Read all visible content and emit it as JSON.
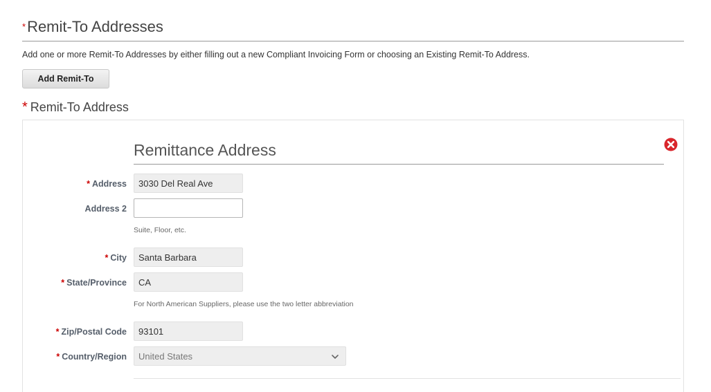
{
  "section": {
    "required_marker": "*",
    "title": "Remit-To Addresses",
    "description": "Add one or more Remit-To Addresses by either filling out a new Compliant Invoicing Form or choosing an Existing Remit-To Address.",
    "add_button_label": "Add Remit-To"
  },
  "subsection": {
    "required_marker": "*",
    "title": "Remit-To Address"
  },
  "panel": {
    "heading": "Remittance Address",
    "close_icon": "close-circle-icon",
    "close_color": "#d9262c",
    "fields": {
      "address": {
        "required": "*",
        "label": "Address",
        "value": "3030 Del Real Ave"
      },
      "address2": {
        "label": "Address 2",
        "value": "",
        "hint": "Suite, Floor, etc."
      },
      "city": {
        "required": "*",
        "label": "City",
        "value": "Santa Barbara"
      },
      "state": {
        "required": "*",
        "label": "State/Province",
        "value": "CA",
        "hint": "For North American Suppliers, please use the two letter abbreviation"
      },
      "zip": {
        "required": "*",
        "label": "Zip/Postal Code",
        "value": "93101"
      },
      "country": {
        "required": "*",
        "label": "Country/Region",
        "value": "United States",
        "icon": "chevron-down-icon"
      }
    }
  },
  "colors": {
    "required": "#cc0000",
    "label": "#555e6a"
  }
}
